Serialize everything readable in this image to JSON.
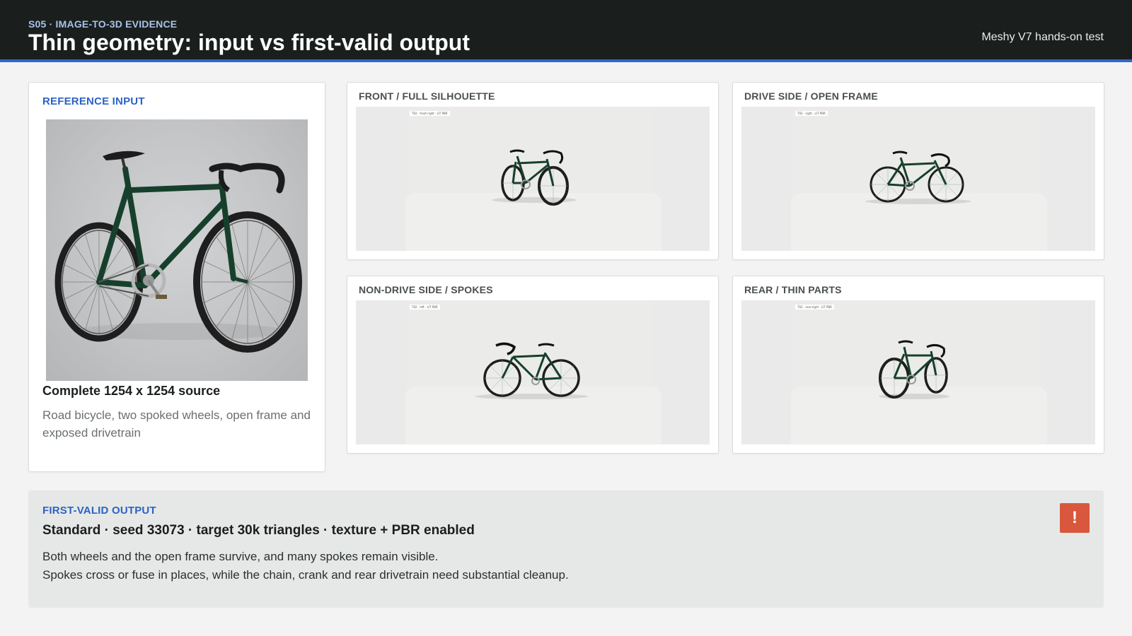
{
  "header": {
    "eyebrow": "S05 · IMAGE-TO-3D EVIDENCE",
    "title": "Thin geometry: input vs first-valid output",
    "meta": "Meshy V7 hands-on test"
  },
  "reference": {
    "label": "REFERENCE INPUT",
    "caption": "Complete 1254 x 1254 source",
    "description": "Road bicycle, two spoked wheels, open frame and exposed drivetrain"
  },
  "views": [
    {
      "label": "FRONT / FULL SILHOUETTE",
      "tag": "T02 · front-right · LIT PBR"
    },
    {
      "label": "DRIVE SIDE / OPEN FRAME",
      "tag": "T02 · right · LIT PBR"
    },
    {
      "label": "NON-DRIVE SIDE / SPOKES",
      "tag": "T02 · left · LIT PBR"
    },
    {
      "label": "REAR / THIN PARTS",
      "tag": "T02 · rear-right · LIT PBR"
    }
  ],
  "output": {
    "label": "FIRST-VALID OUTPUT",
    "spec": "Standard · seed 33073 · target 30k triangles · texture + PBR enabled",
    "line1": "Both wheels and the open frame survive, and many spokes remain visible.",
    "line2": "Spokes cross or fuse in places, while the chain, crank and rear drivetrain need substantial cleanup.",
    "alert_symbol": "!"
  },
  "colors": {
    "header_bg": "#1a1f1e",
    "accent": "#2f66c9",
    "frame_green": "#17402c",
    "alert": "#d9573c"
  }
}
